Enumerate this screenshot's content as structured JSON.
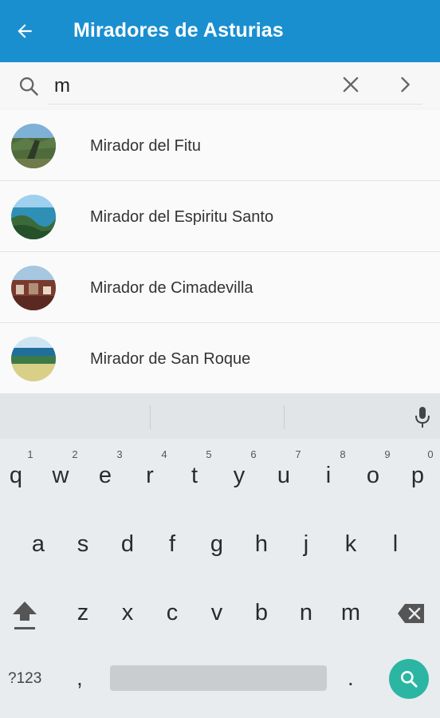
{
  "app_bar": {
    "title": "Miradores de Asturias",
    "back_icon": "arrow-left-icon",
    "background": "#1a8fd0"
  },
  "search": {
    "query": "m",
    "search_icon": "search-icon",
    "clear_icon": "close-icon",
    "submit_icon": "chevron-right-icon"
  },
  "results": [
    {
      "label": "Mirador del Fitu",
      "thumb": "photo-mountain-viewpoint"
    },
    {
      "label": "Mirador del Espiritu Santo",
      "thumb": "photo-coast-estuary"
    },
    {
      "label": "Mirador de Cimadevilla",
      "thumb": "photo-city-rooftops"
    },
    {
      "label": "Mirador de San Roque",
      "thumb": "photo-beach-town"
    }
  ],
  "keyboard": {
    "row1": [
      "q",
      "w",
      "e",
      "r",
      "t",
      "y",
      "u",
      "i",
      "o",
      "p"
    ],
    "row1_hints": [
      "1",
      "2",
      "3",
      "4",
      "5",
      "6",
      "7",
      "8",
      "9",
      "0"
    ],
    "row2": [
      "a",
      "s",
      "d",
      "f",
      "g",
      "h",
      "j",
      "k",
      "l"
    ],
    "row3": [
      "z",
      "x",
      "c",
      "v",
      "b",
      "n",
      "m"
    ],
    "symbols_label": "?123",
    "comma": ",",
    "period": ".",
    "accent": "#2bb6a3"
  }
}
